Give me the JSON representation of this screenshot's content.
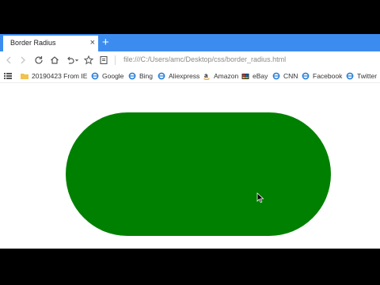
{
  "tab": {
    "title": "Border Radius",
    "close": "×"
  },
  "new_tab": "+",
  "address": {
    "url": "file:///C:/Users/amc/Desktop/css/border_radius.html"
  },
  "bookmarks": [
    {
      "label": "20190423 From IE",
      "icon": "folder-icon"
    },
    {
      "label": "Google",
      "icon": "ie-icon"
    },
    {
      "label": "Bing",
      "icon": "ie-icon"
    },
    {
      "label": "Aliexpress",
      "icon": "ie-icon"
    },
    {
      "label": "Amazon",
      "icon": "amazon-icon"
    },
    {
      "label": "eBay",
      "icon": "ebay-icon"
    },
    {
      "label": "CNN",
      "icon": "ie-icon"
    },
    {
      "label": "Facebook",
      "icon": "ie-icon"
    },
    {
      "label": "Twitter",
      "icon": "ie-icon"
    }
  ],
  "colors": {
    "tab_strip": "#3c8cf0",
    "pill": "#008000",
    "folder": "#f2c14e",
    "ie": "#2a7fd6"
  }
}
